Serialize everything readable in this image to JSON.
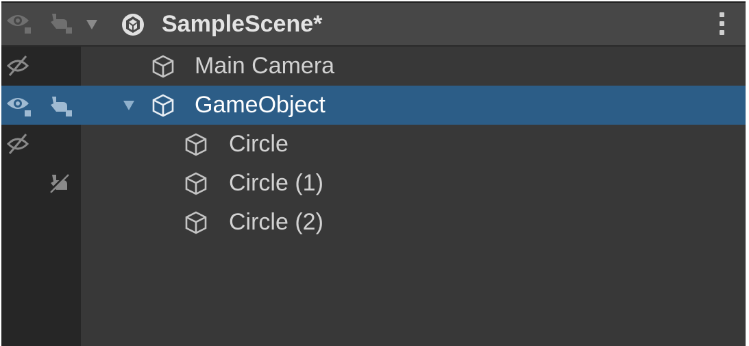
{
  "scene": {
    "name": "SampleScene*",
    "icon": "unity-scene-icon",
    "menu_icon": "kebab-menu-icon"
  },
  "rows": [
    {
      "label": "Main Camera",
      "icon": "cube-icon",
      "visibility": "hidden",
      "picking": "none",
      "selected": false,
      "expanded": null
    },
    {
      "label": "GameObject",
      "icon": "cube-icon",
      "visibility": "visible",
      "picking": "enabled",
      "selected": true,
      "expanded": true
    },
    {
      "label": "Circle",
      "icon": "cube-icon",
      "visibility": "hidden",
      "picking": "none",
      "selected": false,
      "expanded": null
    },
    {
      "label": "Circle (1)",
      "icon": "cube-icon",
      "visibility": "none",
      "picking": "disabled",
      "selected": false,
      "expanded": null
    },
    {
      "label": "Circle (2)",
      "icon": "cube-icon",
      "visibility": "none",
      "picking": "none",
      "selected": false,
      "expanded": null
    }
  ],
  "colors": {
    "panel_background": "#383838",
    "gutter_background": "#262626",
    "header_background": "#474747",
    "selection": "#2c5d87",
    "text": "#d2d2d2"
  }
}
